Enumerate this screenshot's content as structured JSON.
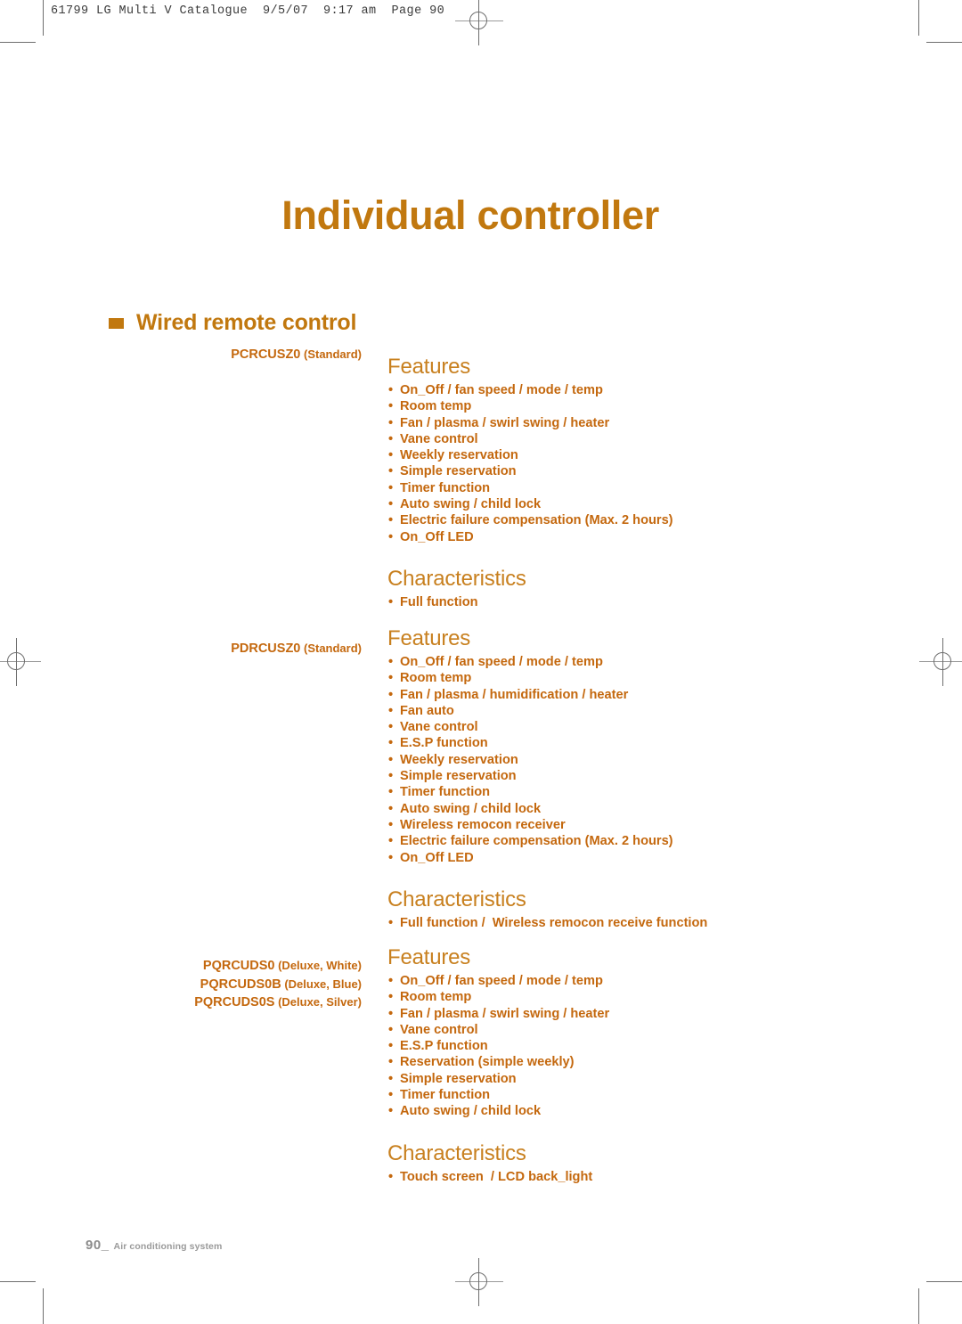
{
  "print_marks": {
    "running_head": "61799 LG Multi V Catalogue  9/5/07  9:17 am  Page 90"
  },
  "page": {
    "title": "Individual controller",
    "section": {
      "bullet_icon": "orange-square-bullet",
      "label": "Wired remote control"
    },
    "blocks": [
      {
        "models": [
          {
            "code": "PCRCUSZ0",
            "variant": "(Standard)"
          }
        ],
        "features_title": "Features",
        "features": [
          "On_Off / fan speed / mode / temp",
          "Room temp",
          "Fan / plasma / swirl swing / heater",
          "Vane control",
          "Weekly reservation",
          "Simple reservation",
          "Timer function",
          "Auto swing / child lock",
          "Electric failure compensation (Max. 2 hours)",
          "On_Off LED"
        ],
        "characteristics_title": "Characteristics",
        "characteristics": [
          "Full function"
        ]
      },
      {
        "models": [
          {
            "code": "PDRCUSZ0",
            "variant": "(Standard)"
          }
        ],
        "features_title": "Features",
        "features": [
          "On_Off / fan speed / mode / temp",
          "Room temp",
          "Fan / plasma / humidification / heater",
          "Fan auto",
          "Vane control",
          "E.S.P function",
          "Weekly reservation",
          "Simple reservation",
          "Timer function",
          "Auto swing / child lock",
          "Wireless remocon receiver",
          "Electric failure compensation (Max. 2 hours)",
          "On_Off LED"
        ],
        "characteristics_title": "Characteristics",
        "characteristics": [
          "Full function /  Wireless remocon receive function"
        ]
      },
      {
        "models": [
          {
            "code": "PQRCUDS0",
            "variant": "(Deluxe, White)"
          },
          {
            "code": "PQRCUDS0B",
            "variant": "(Deluxe, Blue)"
          },
          {
            "code": "PQRCUDS0S",
            "variant": "(Deluxe, Silver)"
          }
        ],
        "features_title": "Features",
        "features": [
          "On_Off / fan speed / mode / temp",
          "Room temp",
          "Fan / plasma / swirl swing / heater",
          "Vane control",
          "E.S.P function",
          "Reservation (simple weekly)",
          "Simple reservation",
          "Timer function",
          "Auto swing / child lock"
        ],
        "characteristics_title": "Characteristics",
        "characteristics": [
          "Touch screen  / LCD back_light"
        ]
      }
    ],
    "footer": {
      "page_number": "90_",
      "text": "Air conditioning system"
    }
  },
  "colors": {
    "accent": "#c1780f",
    "body_text": "#c4680e",
    "heading": "#c8801f",
    "footer": "#8b8b8b",
    "mark": "#6e6e6e"
  }
}
